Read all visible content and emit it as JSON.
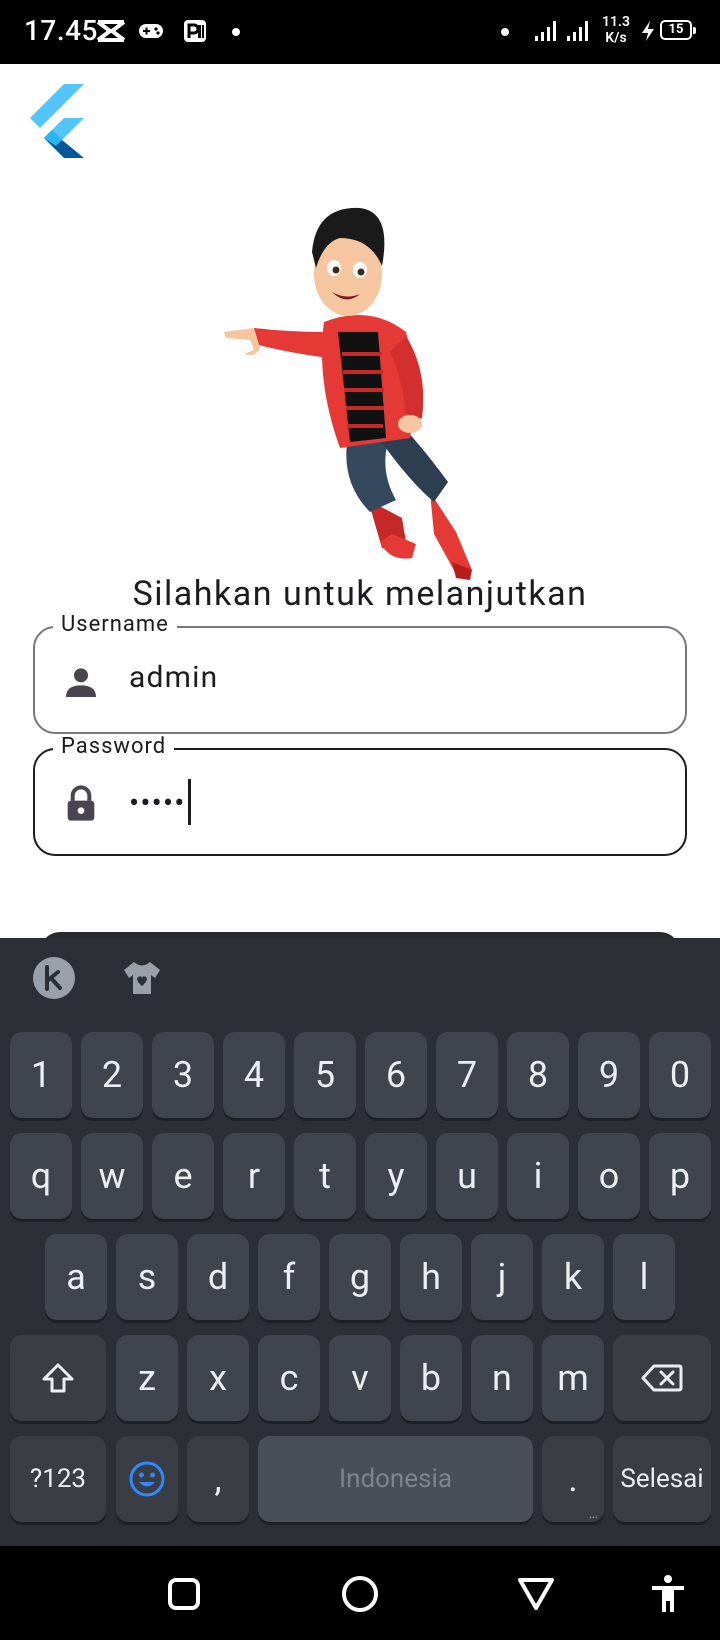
{
  "status_bar": {
    "time": "17.45",
    "network_speed_value": "11.3",
    "network_speed_unit": "K/s",
    "battery_level": "15",
    "icons": [
      "capcut-icon",
      "game-controller-icon",
      "parking-app-icon",
      "notification-dot-icon",
      "signal-icon",
      "signal-icon",
      "charging-icon",
      "battery-icon"
    ]
  },
  "app": {
    "logo": "flutter-logo",
    "illustration": "3d-cartoon-boy-flying",
    "title": "Silahkan untuk melanjutkan",
    "username": {
      "label": "Username",
      "value": "admin",
      "icon": "person-icon"
    },
    "password": {
      "label": "Password",
      "value": "•••••",
      "icon": "lock-icon"
    },
    "colors": {
      "field_border": "#79747e",
      "focused_border": "#1c1b1f",
      "text": "#1c1b1f"
    }
  },
  "keyboard": {
    "toolbar": {
      "icons": [
        "kika-k-icon",
        "theme-shirt-icon"
      ]
    },
    "rows": [
      [
        "1",
        "2",
        "3",
        "4",
        "5",
        "6",
        "7",
        "8",
        "9",
        "0"
      ],
      [
        "q",
        "w",
        "e",
        "r",
        "t",
        "y",
        "u",
        "i",
        "o",
        "p"
      ],
      [
        "a",
        "s",
        "d",
        "f",
        "g",
        "h",
        "j",
        "k",
        "l"
      ],
      [
        "z",
        "x",
        "c",
        "v",
        "b",
        "n",
        "m"
      ]
    ],
    "shift_icon": "shift-icon",
    "backspace_icon": "backspace-icon",
    "symbols_label": "?123",
    "emoji_icon": "emoji-icon",
    "comma": ",",
    "space_label": "Indonesia",
    "period": ".",
    "period_hint": "…",
    "action_label": "Selesai"
  },
  "nav_bar": {
    "buttons": [
      "recents-square-icon",
      "home-circle-icon",
      "back-triangle-icon",
      "accessibility-icon"
    ]
  }
}
